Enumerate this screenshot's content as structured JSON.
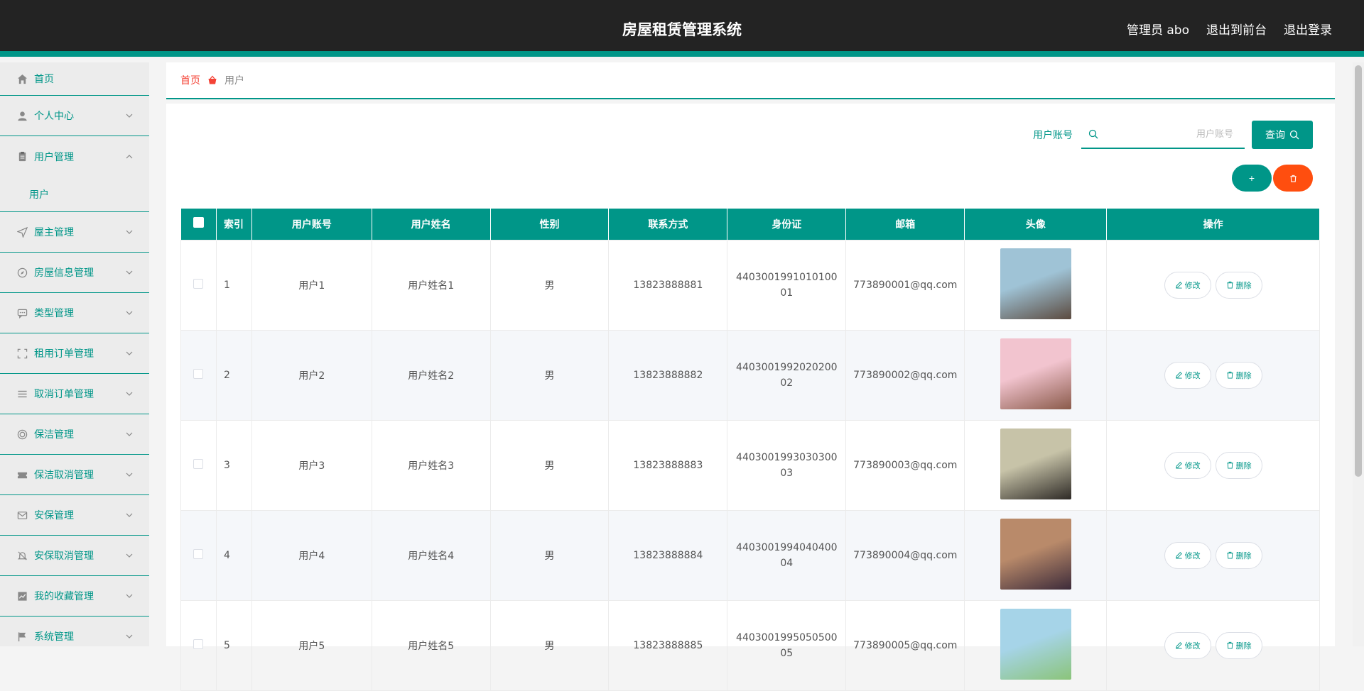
{
  "header": {
    "title": "房屋租赁管理系统",
    "admin_label": "管理员 abo",
    "front_link": "退出到前台",
    "logout_link": "退出登录"
  },
  "sidebar": {
    "items": [
      {
        "label": "首页",
        "icon": "home-icon"
      },
      {
        "label": "个人中心",
        "icon": "user-icon"
      },
      {
        "label": "用户管理",
        "icon": "clipboard-icon",
        "expanded": true,
        "sub": "用户"
      },
      {
        "label": "屋主管理",
        "icon": "send-icon"
      },
      {
        "label": "房屋信息管理",
        "icon": "compass-icon"
      },
      {
        "label": "类型管理",
        "icon": "chat-icon"
      },
      {
        "label": "租用订单管理",
        "icon": "scan-icon"
      },
      {
        "label": "取消订单管理",
        "icon": "list-icon"
      },
      {
        "label": "保洁管理",
        "icon": "ring-icon"
      },
      {
        "label": "保洁取消管理",
        "icon": "ticket-icon"
      },
      {
        "label": "安保管理",
        "icon": "mail-icon"
      },
      {
        "label": "安保取消管理",
        "icon": "bell-off-icon"
      },
      {
        "label": "我的收藏管理",
        "icon": "chart-icon"
      },
      {
        "label": "系统管理",
        "icon": "flag-icon"
      }
    ]
  },
  "breadcrumb": {
    "home": "首页",
    "current": "用户"
  },
  "search": {
    "label": "用户账号",
    "placeholder": "用户账号",
    "button": "查询"
  },
  "actions": {
    "add": "+",
    "delete_icon": "trash-icon"
  },
  "table": {
    "headers": [
      "索引",
      "用户账号",
      "用户姓名",
      "性别",
      "联系方式",
      "身份证",
      "邮箱",
      "头像",
      "操作"
    ],
    "edit_label": "修改",
    "delete_label": "删除",
    "rows": [
      {
        "index": "1",
        "account": "用户1",
        "name": "用户姓名1",
        "gender": "男",
        "phone": "13823888881",
        "id_card": "440300199101010001",
        "email": "773890001@qq.com",
        "avatar_colors": [
          "#9fc3d6",
          "#5b4a3f"
        ]
      },
      {
        "index": "2",
        "account": "用户2",
        "name": "用户姓名2",
        "gender": "男",
        "phone": "13823888882",
        "id_card": "440300199202020002",
        "email": "773890002@qq.com",
        "avatar_colors": [
          "#f2c4cf",
          "#8a5a4a"
        ]
      },
      {
        "index": "3",
        "account": "用户3",
        "name": "用户姓名3",
        "gender": "男",
        "phone": "13823888883",
        "id_card": "440300199303030003",
        "email": "773890003@qq.com",
        "avatar_colors": [
          "#c7c3a8",
          "#2e2a26"
        ]
      },
      {
        "index": "4",
        "account": "用户4",
        "name": "用户姓名4",
        "gender": "男",
        "phone": "13823888884",
        "id_card": "440300199404040004",
        "email": "773890004@qq.com",
        "avatar_colors": [
          "#b98a6a",
          "#3d2b3a"
        ]
      },
      {
        "index": "5",
        "account": "用户5",
        "name": "用户姓名5",
        "gender": "男",
        "phone": "13823888885",
        "id_card": "440300199505050005",
        "email": "773890005@qq.com",
        "avatar_colors": [
          "#a6d4e8",
          "#8bc47a"
        ]
      }
    ]
  },
  "colors": {
    "accent": "#009688",
    "danger": "#ff4e0f",
    "header_bg": "#232323"
  }
}
